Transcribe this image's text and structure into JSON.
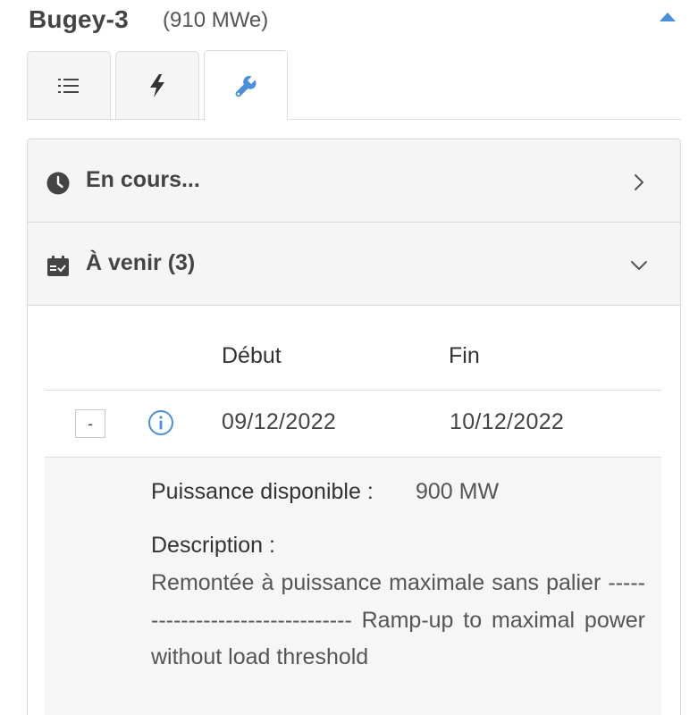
{
  "header": {
    "title": "Bugey-3",
    "capacity": "(910 MWe)"
  },
  "tabs": [
    {
      "icon": "list-icon"
    },
    {
      "icon": "bolt-icon"
    },
    {
      "icon": "wrench-icon",
      "active": true
    }
  ],
  "sections": {
    "in_progress": {
      "label": "En cours..."
    },
    "upcoming": {
      "label": "À venir (3)"
    }
  },
  "table": {
    "columns": [
      "Début",
      "Fin"
    ],
    "rows": [
      {
        "toggle": "-",
        "start": "09/12/2022",
        "end": "10/12/2022"
      }
    ]
  },
  "detail": {
    "power_label": "Puissance disponible :",
    "power_value": "900 MW",
    "description_label": "Description :",
    "description_text": "Remontée à puissance maximale sans palier -------------------------------- Ramp-up to maximal power without load threshold"
  },
  "colors": {
    "accent": "#4a90d9",
    "header_bg": "#f5f5f5",
    "text_dark": "#444444"
  }
}
